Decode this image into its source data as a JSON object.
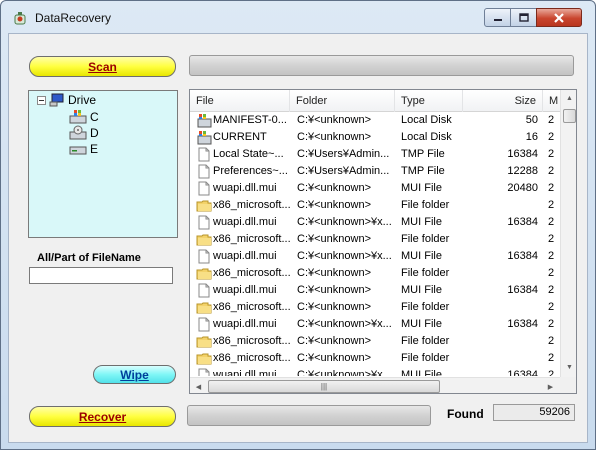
{
  "window": {
    "title": "DataRecovery"
  },
  "buttons": {
    "scan": "Scan",
    "wipe": "Wipe",
    "recover": "Recover"
  },
  "tree": {
    "root": "Drive",
    "drives": [
      "C",
      "D",
      "E"
    ]
  },
  "filename": {
    "label": "All/Part of FileName",
    "value": ""
  },
  "list": {
    "columns": [
      "File",
      "Folder",
      "Type",
      "Size",
      "M"
    ],
    "rows": [
      {
        "icon": "system-file-icon",
        "file": "MANIFEST-0...",
        "folder": "C:¥<unknown>",
        "type": "Local Disk",
        "size": "50",
        "mod": "2"
      },
      {
        "icon": "system-file-icon",
        "file": "CURRENT",
        "folder": "C:¥<unknown>",
        "type": "Local Disk",
        "size": "16",
        "mod": "2"
      },
      {
        "icon": "file-icon",
        "file": "Local State~...",
        "folder": "C:¥Users¥Admin...",
        "type": "TMP File",
        "size": "16384",
        "mod": "2"
      },
      {
        "icon": "file-icon",
        "file": "Preferences~...",
        "folder": "C:¥Users¥Admin...",
        "type": "TMP File",
        "size": "12288",
        "mod": "2"
      },
      {
        "icon": "file-icon",
        "file": "wuapi.dll.mui",
        "folder": "C:¥<unknown>",
        "type": "MUI File",
        "size": "20480",
        "mod": "2"
      },
      {
        "icon": "folder-icon",
        "file": "x86_microsoft...",
        "folder": "C:¥<unknown>",
        "type": "File folder",
        "size": "",
        "mod": "2"
      },
      {
        "icon": "file-icon",
        "file": "wuapi.dll.mui",
        "folder": "C:¥<unknown>¥x...",
        "type": "MUI File",
        "size": "16384",
        "mod": "2"
      },
      {
        "icon": "folder-icon",
        "file": "x86_microsoft...",
        "folder": "C:¥<unknown>",
        "type": "File folder",
        "size": "",
        "mod": "2"
      },
      {
        "icon": "file-icon",
        "file": "wuapi.dll.mui",
        "folder": "C:¥<unknown>¥x...",
        "type": "MUI File",
        "size": "16384",
        "mod": "2"
      },
      {
        "icon": "folder-icon",
        "file": "x86_microsoft...",
        "folder": "C:¥<unknown>",
        "type": "File folder",
        "size": "",
        "mod": "2"
      },
      {
        "icon": "file-icon",
        "file": "wuapi.dll.mui",
        "folder": "C:¥<unknown>",
        "type": "MUI File",
        "size": "16384",
        "mod": "2"
      },
      {
        "icon": "folder-icon",
        "file": "x86_microsoft...",
        "folder": "C:¥<unknown>",
        "type": "File folder",
        "size": "",
        "mod": "2"
      },
      {
        "icon": "file-icon",
        "file": "wuapi.dll.mui",
        "folder": "C:¥<unknown>¥x...",
        "type": "MUI File",
        "size": "16384",
        "mod": "2"
      },
      {
        "icon": "folder-icon",
        "file": "x86_microsoft...",
        "folder": "C:¥<unknown>",
        "type": "File folder",
        "size": "",
        "mod": "2"
      },
      {
        "icon": "folder-icon",
        "file": "x86_microsoft...",
        "folder": "C:¥<unknown>",
        "type": "File folder",
        "size": "",
        "mod": "2"
      },
      {
        "icon": "file-icon",
        "file": "wuapi.dll.mui",
        "folder": "C:¥<unknown>¥x...",
        "type": "MUI File",
        "size": "16384",
        "mod": "2"
      }
    ]
  },
  "found": {
    "label": "Found",
    "value": "59206"
  },
  "colors": {
    "yellow_button": "#ffff40",
    "cyan_button": "#7ff6f6",
    "tree_bg": "#d9f8f9",
    "recover_text": "#9b0000",
    "wipe_text": "#003f9b"
  }
}
